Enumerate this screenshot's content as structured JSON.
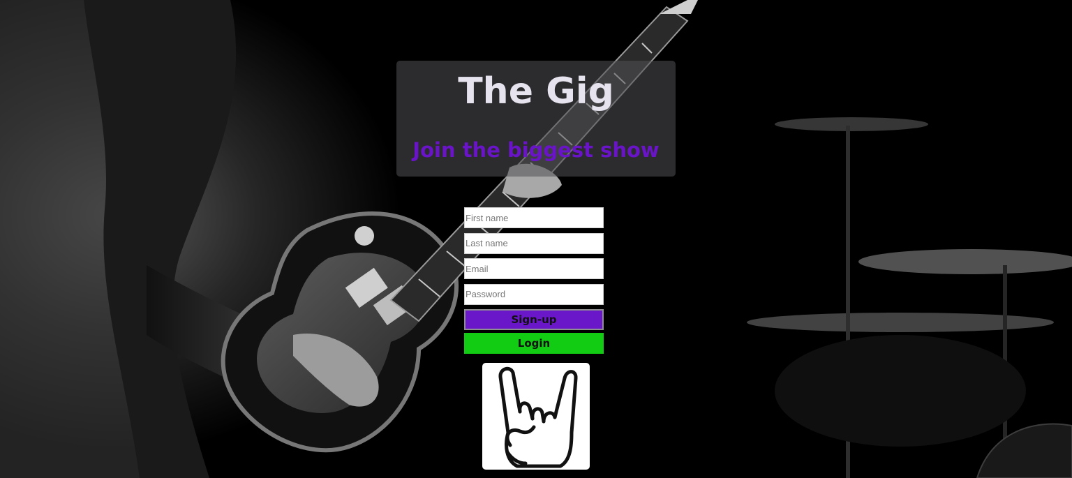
{
  "hero": {
    "title": "The Gig",
    "subtitle": "Join the biggest show"
  },
  "form": {
    "first_name_placeholder": "First name",
    "last_name_placeholder": "Last name",
    "email_placeholder": "Email",
    "password_placeholder": "Password",
    "signup_label": "Sign-up",
    "login_label": "Login"
  },
  "colors": {
    "subtitle": "#6a14c8",
    "signup_button": "#6a17c9",
    "login_button": "#12cc14",
    "hero_panel": "rgba(80,80,84,0.55)"
  },
  "logo": {
    "icon": "rock-hand-icon"
  }
}
